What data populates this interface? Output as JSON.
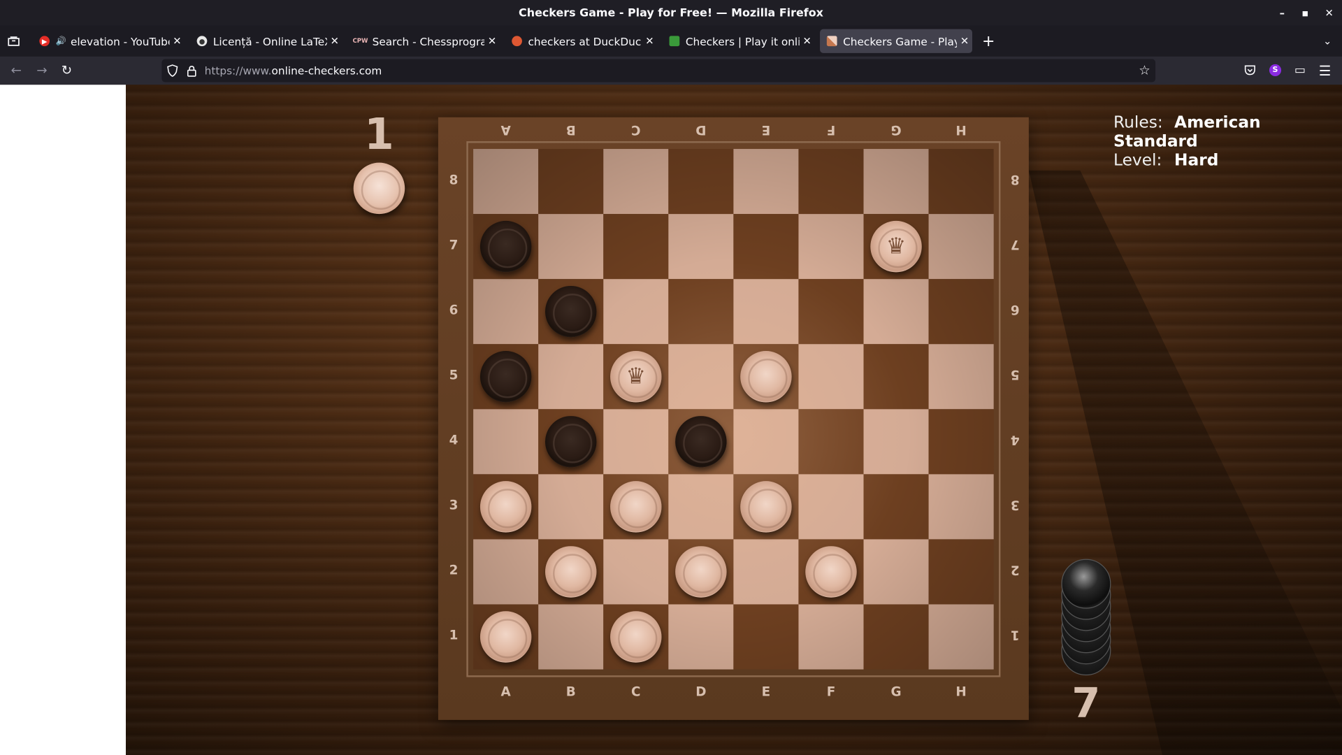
{
  "window": {
    "title": "Checkers Game - Play for Free! — Mozilla Firefox"
  },
  "tabs": [
    {
      "label": "elevation - YouTube M",
      "icon": "youtube-icon",
      "audio": true
    },
    {
      "label": "Licență - Online LaTeX Ed",
      "icon": "overleaf-icon"
    },
    {
      "label": "Search - Chessprogramm",
      "icon": "chessprogramming-icon"
    },
    {
      "label": "checkers at DuckDuckGo",
      "icon": "duckduckgo-icon"
    },
    {
      "label": "Checkers | Play it online!",
      "icon": "checkers-site-icon"
    },
    {
      "label": "Checkers Game - Play for",
      "icon": "online-checkers-icon",
      "active": true
    }
  ],
  "navbar": {
    "url_scheme": "https://www.",
    "url_host": "online-checkers.com"
  },
  "game": {
    "rules_label": "Rules:",
    "rules_value": "American Standard",
    "level_label": "Level:",
    "level_value": "Hard",
    "captured_by_black_count": "1",
    "captured_by_white_count": "7",
    "files_top": [
      "A",
      "B",
      "C",
      "D",
      "E",
      "F",
      "G",
      "H"
    ],
    "files_bottom": [
      "A",
      "B",
      "C",
      "D",
      "E",
      "F",
      "G",
      "H"
    ],
    "ranks": [
      "8",
      "7",
      "6",
      "5",
      "4",
      "3",
      "2",
      "1"
    ],
    "pieces": [
      {
        "square": "A7",
        "color": "black",
        "king": false
      },
      {
        "square": "G7",
        "color": "white",
        "king": true
      },
      {
        "square": "B6",
        "color": "black",
        "king": false
      },
      {
        "square": "A5",
        "color": "black",
        "king": false
      },
      {
        "square": "C5",
        "color": "white",
        "king": true
      },
      {
        "square": "E5",
        "color": "white",
        "king": false
      },
      {
        "square": "B4",
        "color": "black",
        "king": false
      },
      {
        "square": "D4",
        "color": "black",
        "king": false
      },
      {
        "square": "A3",
        "color": "white",
        "king": false
      },
      {
        "square": "C3",
        "color": "white",
        "king": false
      },
      {
        "square": "E3",
        "color": "white",
        "king": false
      },
      {
        "square": "B2",
        "color": "white",
        "king": false
      },
      {
        "square": "D2",
        "color": "white",
        "king": false
      },
      {
        "square": "F2",
        "color": "white",
        "king": false
      },
      {
        "square": "A1",
        "color": "white",
        "king": false
      },
      {
        "square": "C1",
        "color": "white",
        "king": false
      }
    ],
    "colors": {
      "light_square": "#d4ab95",
      "dark_square": "#6d3f20",
      "coordinate_text": "#d7bfae"
    }
  }
}
